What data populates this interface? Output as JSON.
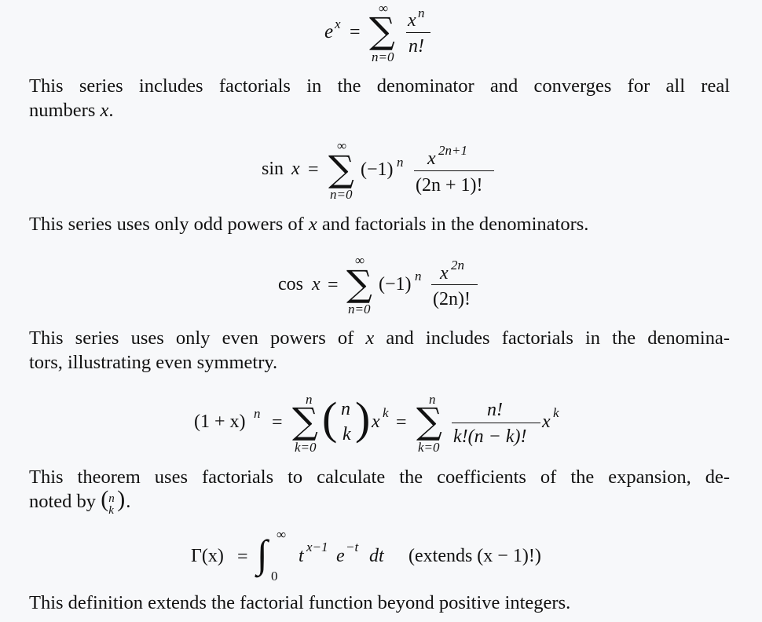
{
  "equations": {
    "exp": {
      "lhs_base": "e",
      "lhs_exp": "x",
      "eq": "=",
      "sum_top": "∞",
      "sum_sym": "∑",
      "sum_bottom": "n=0",
      "num_base": "x",
      "num_exp": "n",
      "den": "n!"
    },
    "sin": {
      "lhs": "sin",
      "lhs_var": "x",
      "eq": "=",
      "sum_top": "∞",
      "sum_sym": "∑",
      "sum_bottom": "n=0",
      "sign_factor": "(−1)",
      "sign_exp": "n",
      "num_base": "x",
      "num_exp": "2n+1",
      "den": "(2n + 1)!"
    },
    "cos": {
      "lhs": "cos",
      "lhs_var": "x",
      "eq": "=",
      "sum_top": "∞",
      "sum_sym": "∑",
      "sum_bottom": "n=0",
      "sign_factor": "(−1)",
      "sign_exp": "n",
      "num_base": "x",
      "num_exp": "2n",
      "den": "(2n)!"
    },
    "binomial": {
      "lhs": "(1 + x)",
      "lhs_exp": "n",
      "eq1": "=",
      "sum1_top": "n",
      "sum1_sym": "∑",
      "sum1_bottom": "k=0",
      "binom_top": "n",
      "binom_bottom": "k",
      "lparen": "(",
      "rparen": ")",
      "term_base": "x",
      "term_exp": "k",
      "eq2": "=",
      "sum2_top": "n",
      "sum2_sym": "∑",
      "sum2_bottom": "k=0",
      "num": "n!",
      "den": "k!(n − k)!",
      "term2_base": "x",
      "term2_exp": "k"
    },
    "gamma": {
      "lhs": "Γ(x)",
      "eq": "=",
      "int_sym": "∫",
      "int_top": "∞",
      "int_bottom": "0",
      "integrand_t": "t",
      "t_exp": "x−1",
      "integrand_e": "e",
      "e_exp": "−t",
      "dt": "dt",
      "note": "(extends (x − 1)!)"
    }
  },
  "paragraphs": {
    "p1_line1": "This series includes factorials in the denominator and converges for all real",
    "p1_line2_text": "numbers ",
    "p1_line2_var": "x",
    "p1_line2_end": ".",
    "p2_pre": "This series uses only odd powers of ",
    "p2_var": "x",
    "p2_post": " and factorials in the denominators.",
    "p3_pre": "This series uses only even powers of ",
    "p3_var": "x",
    "p3_post": " and includes factorials in the denomina-",
    "p3_line2": "tors, illustrating even symmetry.",
    "p4_line1": "This theorem uses factorials to calculate the coefficients of the expansion, de-",
    "p4_line2_text": "noted by ",
    "p4_binom_top": "n",
    "p4_binom_bottom": "k",
    "p4_line2_end": ".",
    "p5": "This definition extends the factorial function beyond positive integers."
  }
}
